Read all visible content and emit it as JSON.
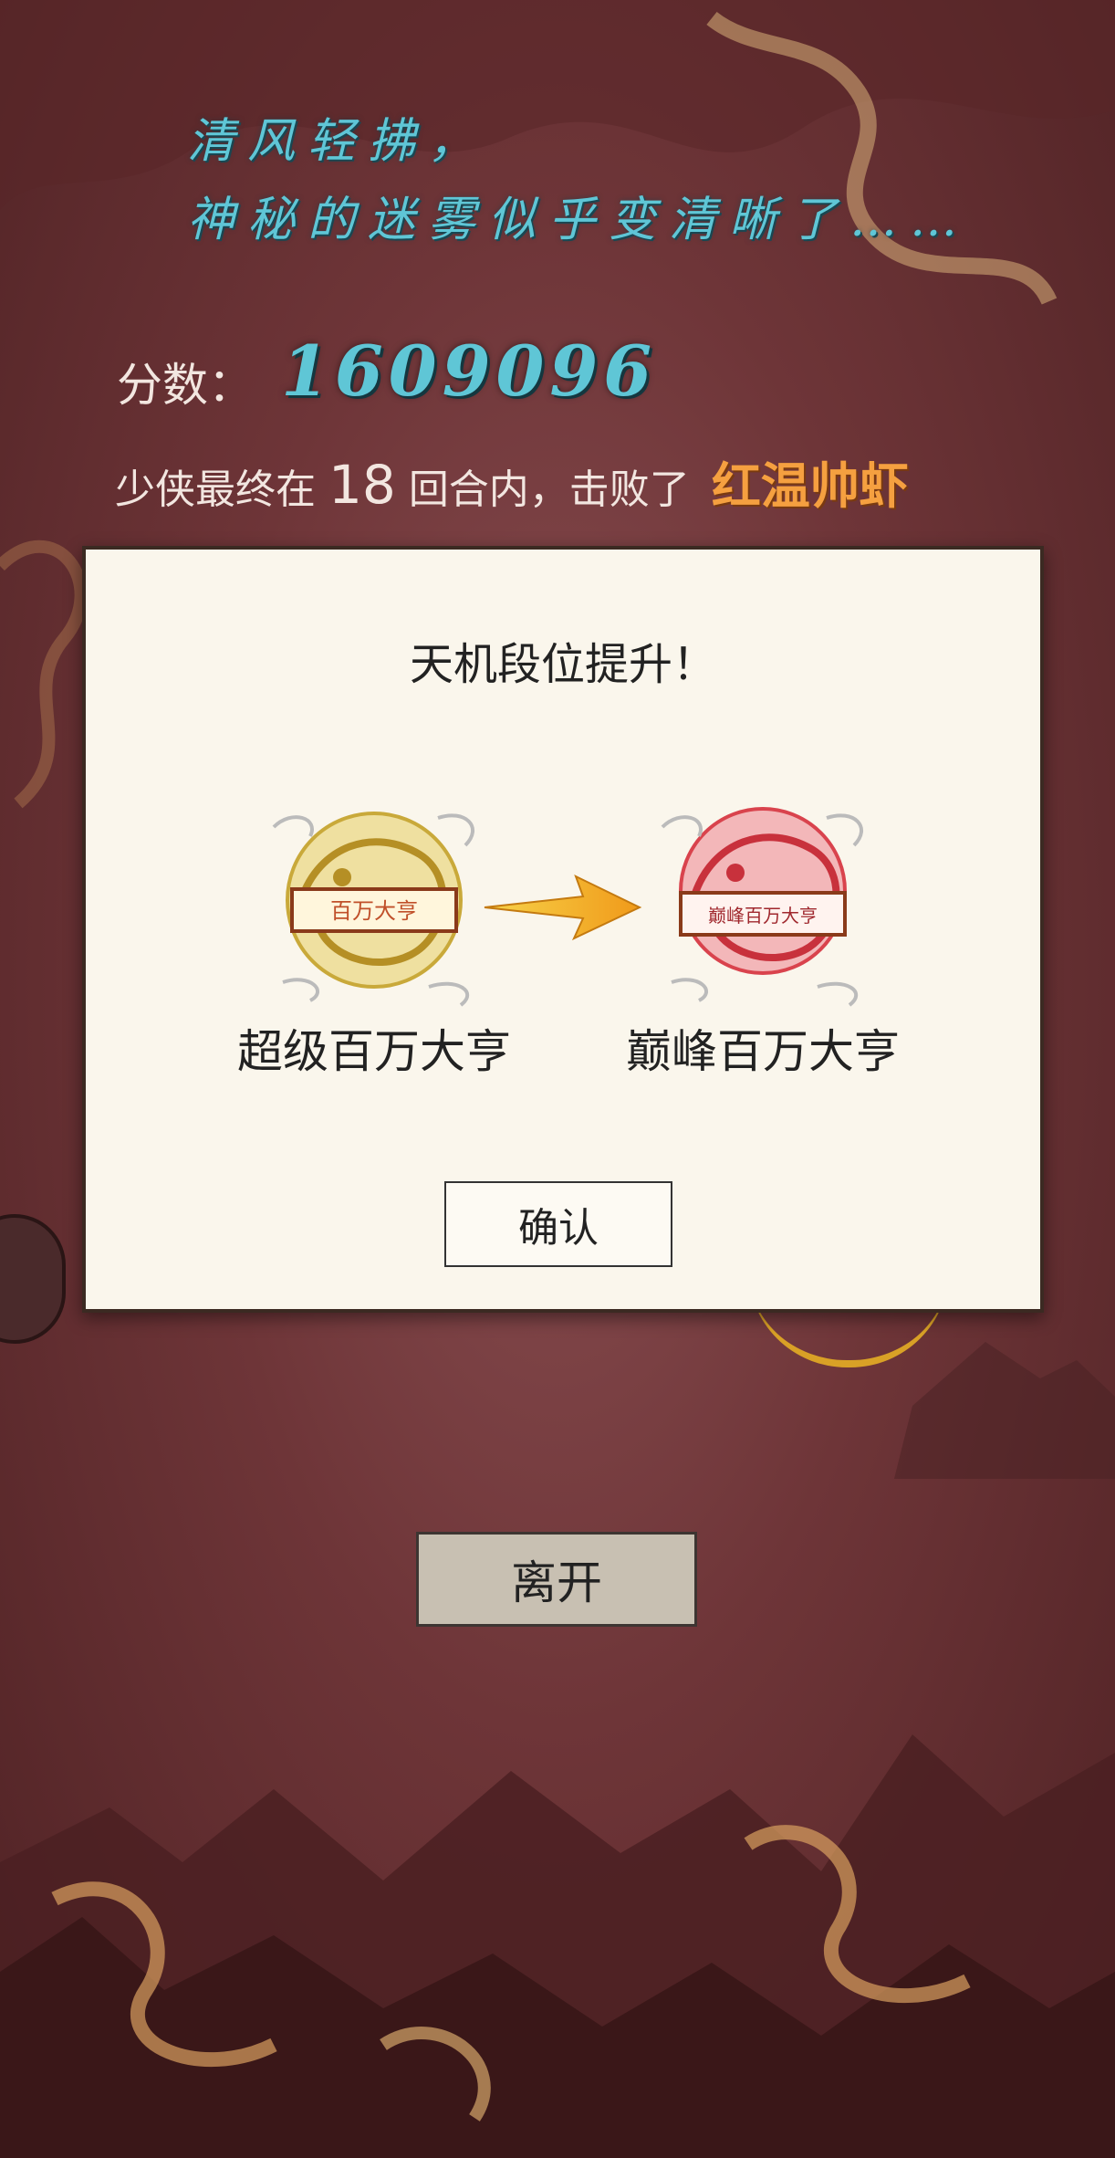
{
  "banner": {
    "line1": "清风轻拂，",
    "line2": "神秘的迷雾似乎变清晰了……"
  },
  "score": {
    "label": "分数：",
    "value": "1609096"
  },
  "result": {
    "prefix": "少侠最终在",
    "rounds": "18",
    "suffix": "回合内，击败了",
    "boss": "红温帅虾"
  },
  "rank_dialog": {
    "title": "天机段位提升！",
    "from_rank": "超级百万大亨",
    "from_plaque": "百万大亨",
    "to_rank": "巅峰百万大亨",
    "to_plaque": "巅峰百万大亨",
    "confirm": "确认",
    "icons": {
      "from": "gold-dragon-badge-icon",
      "to": "red-dragon-badge-icon",
      "arrow": "arrow-right-icon"
    }
  },
  "leave_button": "离开",
  "colors": {
    "background": "#6e3538",
    "banner_text": "#5fc6d6",
    "boss_name": "#f5a040",
    "dialog_bg": "#faf6ec",
    "gold_badge": "#e0c34a",
    "red_badge": "#d9434d"
  }
}
